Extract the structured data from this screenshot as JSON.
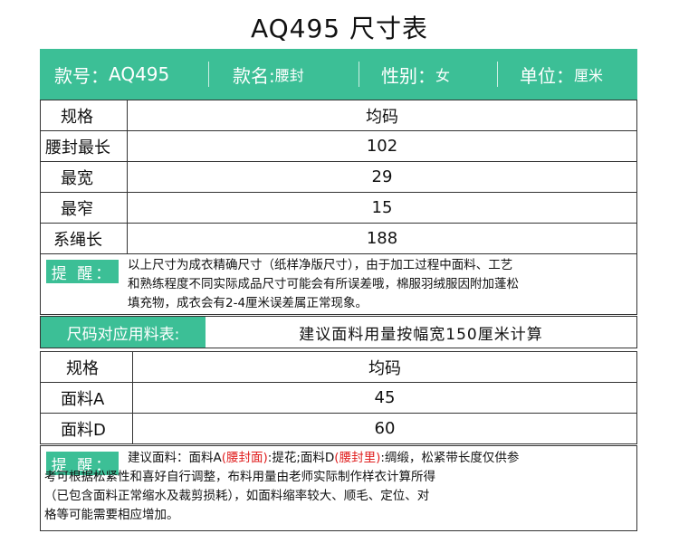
{
  "title": "AQ495 尺寸表",
  "header": {
    "style_no_key": "款号：",
    "style_no_val": "AQ495",
    "name_key": "款名:",
    "name_val": "腰封",
    "gender_key": "性别：",
    "gender_val": "女",
    "unit_key": "单位：",
    "unit_val": "厘米"
  },
  "size_table": {
    "header": [
      "规格",
      "均码"
    ],
    "rows": [
      [
        "腰封最长",
        "102"
      ],
      [
        "最宽",
        "29"
      ],
      [
        "最窄",
        "15"
      ],
      [
        "系绳长",
        "188"
      ]
    ]
  },
  "tip1": {
    "label": "提 醒：",
    "lines": [
      "以上尺寸为成衣精确尺寸（纸样净版尺寸），由于加工过程中面料、工艺",
      "和熟练程度不同实际成品尺寸可能会有所误差哦，棉服羽绒服因附加蓬松",
      "填充物，成衣会有2-4厘米误差属正常现象。"
    ]
  },
  "fabric_section": {
    "label": "尺码对应用料表:",
    "note": "建议面料用量按幅宽150厘米计算"
  },
  "fabric_table": {
    "header": [
      "规格",
      "均码"
    ],
    "rows": [
      [
        "面料A",
        "45"
      ],
      [
        "面料D",
        "60"
      ]
    ]
  },
  "tip2": {
    "label": "提 醒：",
    "line1_a": "建议面料：面料A",
    "line1_b": "(腰封面)",
    "line1_c": ":提花;面料D",
    "line1_d": "(腰封里)",
    "line1_e": ":绸缎，松紧带长度仅供参",
    "line2": "考可根据松紧性和喜好自行调整，布料用量由老师实际制作样衣计算所得",
    "line3": "（已包含面料正常缩水及裁剪损耗），如面料缩率较大、顺毛、定位、对",
    "line4": "格等可能需要相应增加。"
  },
  "colors": {
    "accent": "#3cbf96",
    "highlight": "#e02020"
  }
}
